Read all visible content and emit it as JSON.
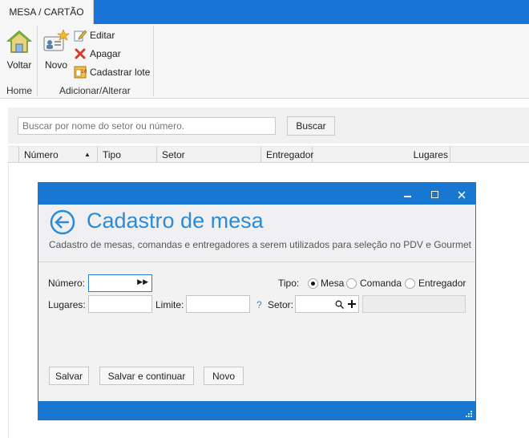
{
  "ribbon": {
    "tab_label": "MESA / CARTÃO",
    "groups": {
      "home": {
        "label": "Home",
        "voltar_label": "Voltar"
      },
      "add_edit": {
        "label": "Adicionar/Alterar",
        "novo_label": "Novo",
        "editar_label": "Editar",
        "apagar_label": "Apagar",
        "cadastrar_lote_label": "Cadastrar lote"
      }
    }
  },
  "search": {
    "placeholder": "Buscar por nome do setor ou número.",
    "button_label": "Buscar"
  },
  "table": {
    "columns": [
      "Número",
      "Tipo",
      "Setor",
      "Entregador",
      "Lugares"
    ],
    "sorted_column": "Número",
    "sort_direction": "ascending"
  },
  "dialog": {
    "title": "Cadastro de mesa",
    "subtitle": "Cadastro de mesas, comandas e entregadores a serem utilizados para seleção no PDV e Gourmet",
    "fields": {
      "numero_label": "Número:",
      "numero_value": "",
      "lugares_label": "Lugares:",
      "lugares_value": "",
      "limite_label": "Limite:",
      "limite_value": "",
      "help_glyph": "?",
      "setor_label": "Setor:",
      "setor_value": "",
      "setor_name_value": "",
      "tipo_label": "Tipo:",
      "tipo_options": [
        "Mesa",
        "Comanda",
        "Entregador"
      ],
      "tipo_selected": "Mesa"
    },
    "buttons": {
      "salvar": "Salvar",
      "salvar_continuar": "Salvar e continuar",
      "novo": "Novo"
    }
  },
  "colors": {
    "accent_blue": "#1877d1",
    "title_blue": "#2b8bd6",
    "ribbon_bg": "#f6f6f6"
  }
}
